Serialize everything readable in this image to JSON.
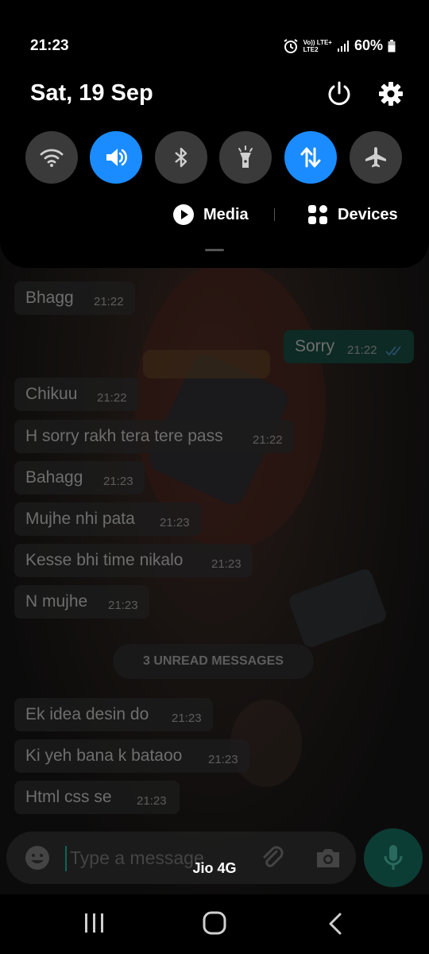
{
  "status_bar": {
    "time": "21:23",
    "network_top": "Vo)) LTE+",
    "network_bottom": "LTE2",
    "battery": "60%"
  },
  "quick_panel": {
    "date": "Sat, 19 Sep",
    "tiles": [
      {
        "name": "wifi",
        "active": false
      },
      {
        "name": "sound",
        "active": true
      },
      {
        "name": "bluetooth",
        "active": false
      },
      {
        "name": "flashlight",
        "active": false
      },
      {
        "name": "mobile-data",
        "active": true
      },
      {
        "name": "airplane-mode",
        "active": false
      }
    ],
    "media_label": "Media",
    "devices_label": "Devices"
  },
  "chat": {
    "messages": [
      {
        "text": "Bhagg",
        "time": "21:22",
        "direction": "in"
      },
      {
        "text": "Sorry",
        "time": "21:22",
        "direction": "out"
      },
      {
        "text": "Chikuu",
        "time": "21:22",
        "direction": "in"
      },
      {
        "text": "H sorry rakh tera tere pass",
        "time": "21:22",
        "direction": "in"
      },
      {
        "text": "Bahagg",
        "time": "21:23",
        "direction": "in"
      },
      {
        "text": "Mujhe nhi pata",
        "time": "21:23",
        "direction": "in"
      },
      {
        "text": "Kesse bhi time nikalo",
        "time": "21:23",
        "direction": "in"
      },
      {
        "text": "N mujhe",
        "time": "21:23",
        "direction": "in"
      },
      {
        "text": "Ek idea desin do",
        "time": "21:23",
        "direction": "in"
      },
      {
        "text": "Ki yeh bana k bataoo",
        "time": "21:23",
        "direction": "in"
      },
      {
        "text": "Html css se",
        "time": "21:23",
        "direction": "in"
      }
    ],
    "unread_banner": "3 UNREAD MESSAGES",
    "input_placeholder": "Type a message",
    "carrier_label": "Jio 4G"
  },
  "colors": {
    "tile_active": "#1a8cff",
    "tile_inactive": "#3a3a3a",
    "panel_bg": "#000000",
    "outgoing_bubble": "#0d2a24",
    "mic_button": "#0c3d35"
  }
}
